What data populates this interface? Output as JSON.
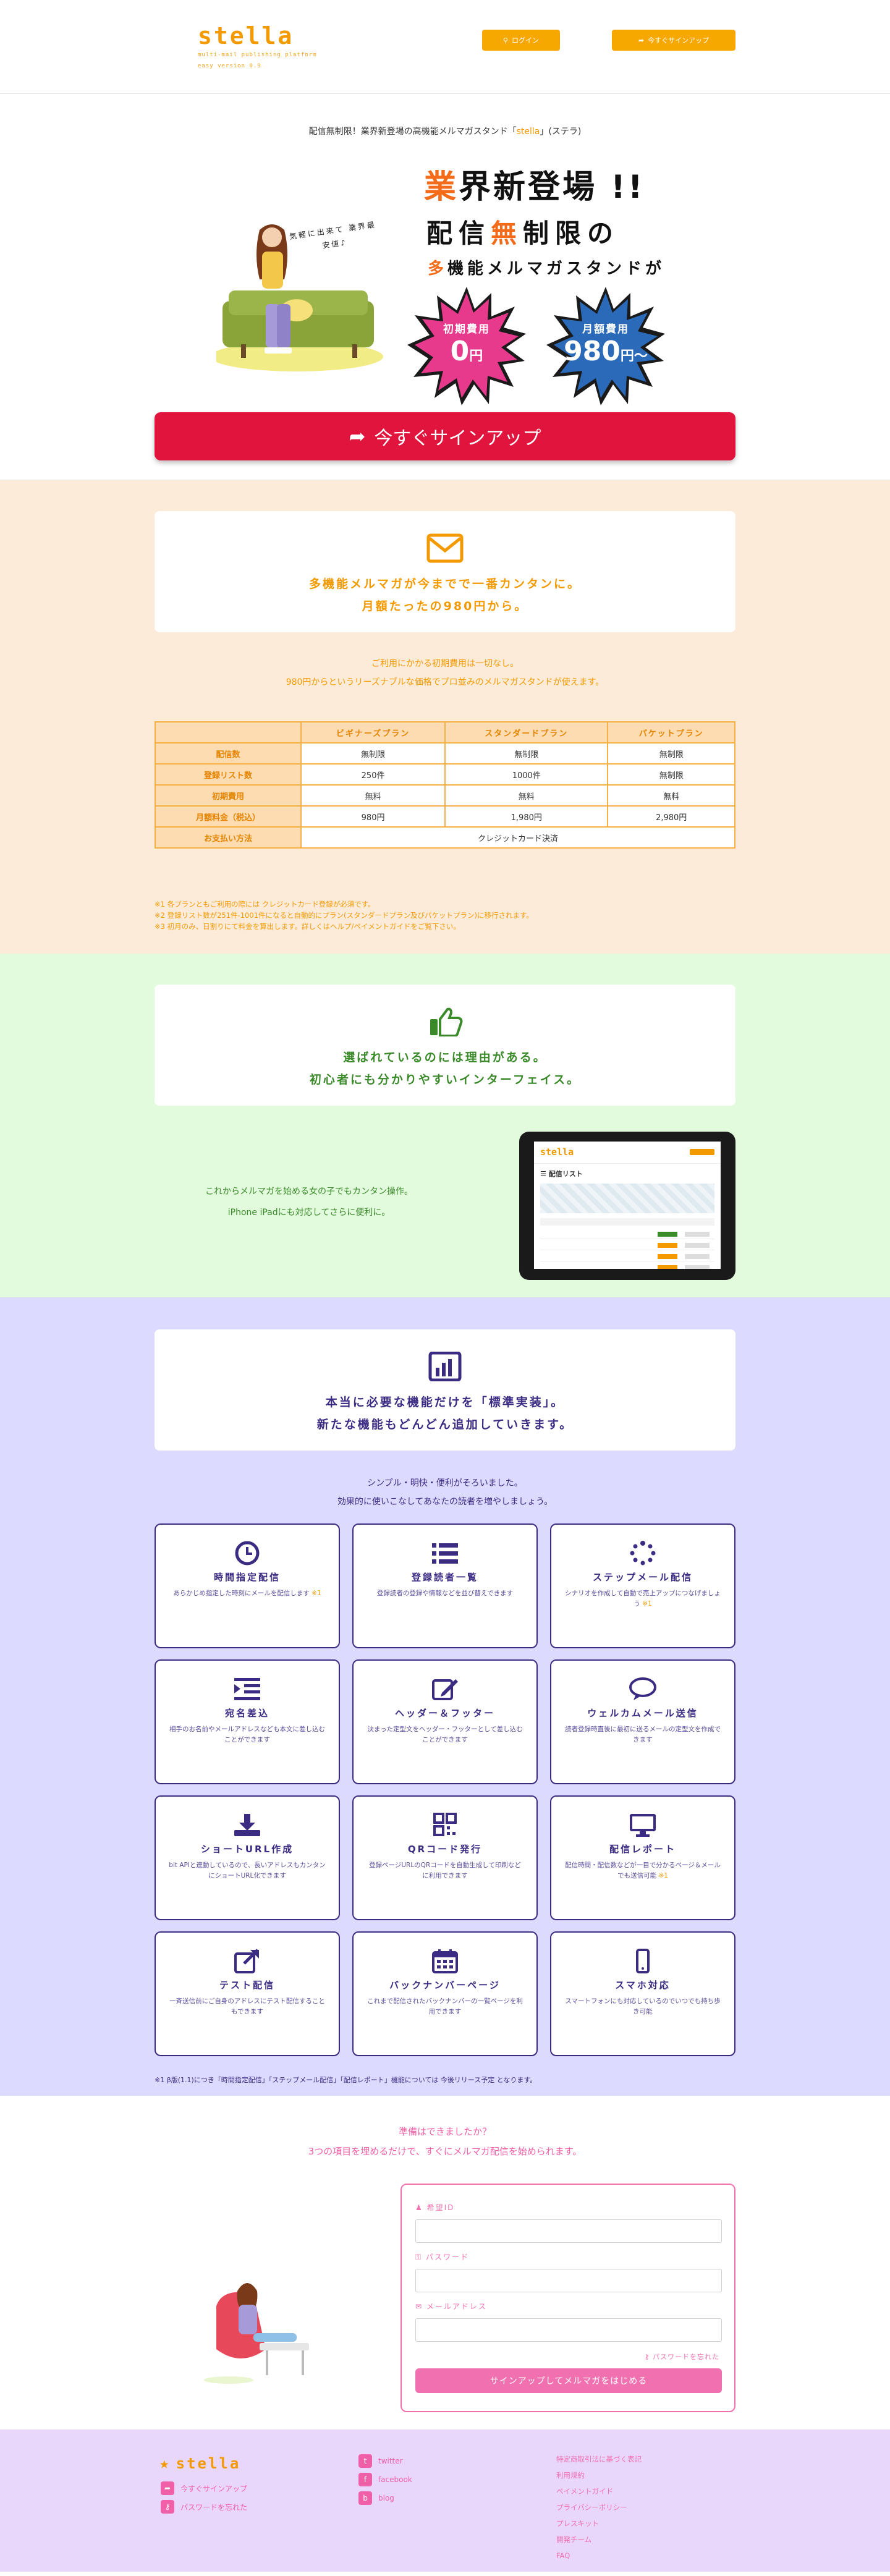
{
  "header": {
    "logo": "stella",
    "tagline": "multi-mail publishing platform",
    "tagline2": "easy version 0.9",
    "login_label": "ログイン",
    "signup_label": "今すぐサインアップ"
  },
  "hero": {
    "lead_prefix": "配信無制限！業界新登場の高機能メルマガスタンド「",
    "lead_accent": "stella",
    "lead_suffix": "」(ステラ)",
    "bubble": "気軽に出来て 業界最安値♪",
    "headline1_a": "業",
    "headline1_b": "界新登場 !!",
    "headline2_a": "配信",
    "headline2_b": "無",
    "headline2_c": "制限の",
    "headline3_a": "多",
    "headline3_b": "機能メルマガスタンドが",
    "burst1_top": "初期費用",
    "burst1_val": "0",
    "burst1_unit": "円",
    "burst2_top": "月額費用",
    "burst2_val": "980",
    "burst2_unit": "円〜",
    "cta_label": "今すぐサインアップ",
    "colors": {
      "burst1": "#e83a8c",
      "burst2": "#2a6ab8",
      "cta": "#e0143c"
    }
  },
  "pricing": {
    "card_line1": "多機能メルマガが今までで一番カンタンに。",
    "card_line2": "月額たったの980円から。",
    "desc_line1": "ご利用にかかる初期費用は一切なし。",
    "desc_line2": "980円からというリーズナブルな価格でプロ並みのメルマガスタンドが使えます。",
    "headers": [
      "",
      "ビギナーズプラン",
      "スタンダードプラン",
      "パケットプラン"
    ],
    "rows": [
      {
        "label": "配信数",
        "cells": [
          "無制限",
          "無制限",
          "無制限"
        ]
      },
      {
        "label": "登録リスト数",
        "cells": [
          "250件",
          "1000件",
          "無制限"
        ]
      },
      {
        "label": "初期費用",
        "cells": [
          "無料",
          "無料",
          "無料"
        ]
      },
      {
        "label": "月額料金（税込）",
        "cells": [
          "980円",
          "1,980円",
          "2,980円"
        ]
      }
    ],
    "payment_label": "お支払い方法",
    "payment_value": "クレジットカード決済",
    "notes": [
      "※1 各プランともご利用の際には クレジットカード登録が必須です。",
      "※2 登録リスト数が251件-1001件になると自動的にプラン(スタンダードプラン及びパケットプラン)に移行されます。",
      "※3 初月のみ、日割りにて料金を算出します。詳しくはヘルプ/ペイメントガイドをご覧下さい。"
    ]
  },
  "interface": {
    "card_line1": "選ばれているのには理由がある。",
    "card_line2": "初心者にも分かりやすいインターフェイス。",
    "desc_line1": "これからメルマガを始める女の子でもカンタン操作。",
    "desc_line2": "iPhone iPadにも対応してさらに便利に。",
    "ipad_logo": "stella",
    "ipad_heading": "配信リスト"
  },
  "features": {
    "card_line1": "本当に必要な機能だけを「標準実装」。",
    "card_line2": "新たな機能もどんどん追加していきます。",
    "desc_line1": "シンプル・明快・便利がそろいました。",
    "desc_line2": "効果的に使いこなしてあなたの読者を増やしましょう。",
    "items": [
      {
        "icon": "clock-icon",
        "title": "時間指定配信",
        "desc": "あらかじめ指定した時刻にメールを配信します",
        "mark": "※1"
      },
      {
        "icon": "list-icon",
        "title": "登録読者一覧",
        "desc": "登録読者の登録や情報などを並び替えできます",
        "mark": ""
      },
      {
        "icon": "spinner-icon",
        "title": "ステップメール配信",
        "desc": "シナリオを作成して自動で売上アップにつなげましょう",
        "mark": "※1"
      },
      {
        "icon": "indent-icon",
        "title": "宛名差込",
        "desc": "相手のお名前やメールアドレスなども本文に差し込むことができます",
        "mark": ""
      },
      {
        "icon": "edit-icon",
        "title": "ヘッダー＆フッター",
        "desc": "決まった定型文をヘッダー・フッターとして差し込むことができます",
        "mark": ""
      },
      {
        "icon": "comment-icon",
        "title": "ウェルカムメール送信",
        "desc": "読者登録時直後に最初に送るメールの定型文を作成できます",
        "mark": ""
      },
      {
        "icon": "download-icon",
        "title": "ショートURL作成",
        "desc": "bit APIと連動しているので、長いアドレスもカンタンにショートURL化できます",
        "mark": ""
      },
      {
        "icon": "qrcode-icon",
        "title": "QRコード発行",
        "desc": "登録ページURLのQRコードを自動生成して印刷などに利用できます",
        "mark": ""
      },
      {
        "icon": "desktop-icon",
        "title": "配信レポート",
        "desc": "配信時間・配信数などが一目で分かるページ＆メールでも送信可能",
        "mark": "※1"
      },
      {
        "icon": "share-icon",
        "title": "テスト配信",
        "desc": "一斉送信前にご自身のアドレスにテスト配信することもできます",
        "mark": ""
      },
      {
        "icon": "calendar-icon",
        "title": "バックナンバーページ",
        "desc": "これまで配信されたバックナンバーの一覧ページを利用できます",
        "mark": ""
      },
      {
        "icon": "mobile-icon",
        "title": "スマホ対応",
        "desc": "スマートフォンにも対応しているのでいつでも持ち歩き可能",
        "mark": ""
      }
    ],
    "note": "※1 β版(1.1)につき「時間指定配信」「ステップメール配信」「配信レポート」機能については 今後リリース予定 となります。"
  },
  "signup": {
    "question1": "準備はできましたか？",
    "question2": "3つの項目を埋めるだけで、すぐにメルマガ配信を始められます。",
    "label_id": "希望ID",
    "label_pw": "パスワード",
    "label_mail": "メールアドレス",
    "forgot": "パスワードを忘れた",
    "submit": "サインアップしてメルマガをはじめる"
  },
  "footer": {
    "logo": "stella",
    "links_left": [
      "今すぐサインアップ",
      "パスワードを忘れた"
    ],
    "links_mid": [
      "twitter",
      "facebook",
      "blog"
    ],
    "links_right": [
      "特定商取引法に基づく表記",
      "利用規約",
      "ペイメントガイド",
      "プライバシーポリシー",
      "プレスキット",
      "開発チーム",
      "FAQ"
    ]
  }
}
